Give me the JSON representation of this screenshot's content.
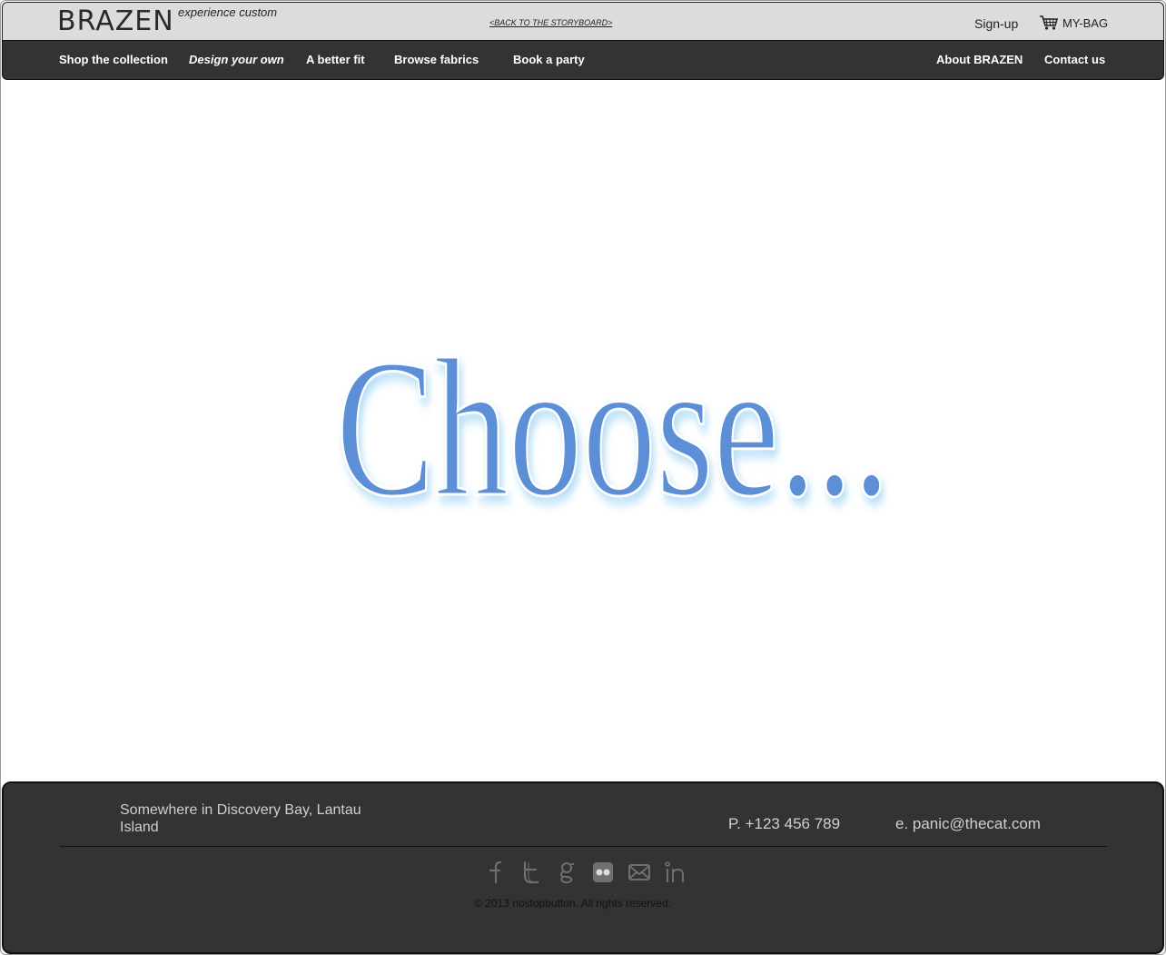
{
  "header": {
    "logo": "BRAZEN",
    "tagline": "experience custom",
    "storyboard_link": "<BACK TO THE STORYBOARD>",
    "signup": "Sign-up",
    "bag_label": "MY-BAG",
    "bag_icon": "shopping-cart-icon"
  },
  "nav": {
    "items": [
      {
        "label": "Shop the collection"
      },
      {
        "label": "Design your own"
      },
      {
        "label": "A better fit"
      },
      {
        "label": "Browse fabrics"
      },
      {
        "label": "Book a party"
      },
      {
        "label": "About BRAZEN"
      },
      {
        "label": "Contact us"
      }
    ]
  },
  "main": {
    "hero_text": "Choose...",
    "hero_color": "#5b8fd6"
  },
  "footer": {
    "address": "Somewhere in Discovery Bay, Lantau Island",
    "phone": "P. +123 456 789",
    "email": "e. panic@thecat.com",
    "social_icons": [
      "facebook-icon",
      "twitter-icon",
      "google-icon",
      "flickr-icon",
      "mail-icon",
      "linkedin-icon"
    ],
    "copyright": "© 2013 nostopbutton. All rights reserved."
  }
}
